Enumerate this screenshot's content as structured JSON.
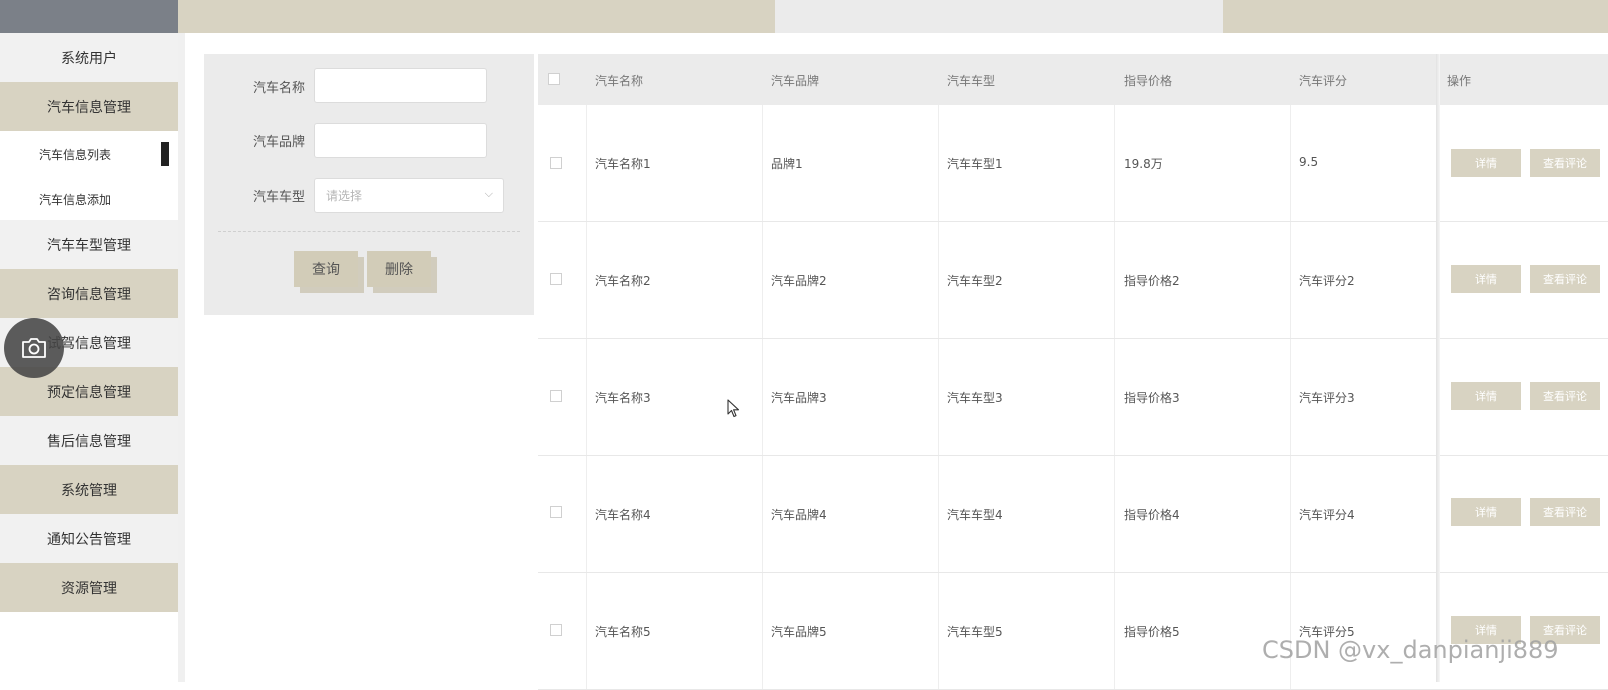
{
  "sidebar": {
    "items": [
      {
        "label": "系统用户"
      },
      {
        "label": "汽车信息管理"
      },
      {
        "label": "汽车车型管理"
      },
      {
        "label": "咨询信息管理"
      },
      {
        "label": "试驾信息管理"
      },
      {
        "label": "预定信息管理"
      },
      {
        "label": "售后信息管理"
      },
      {
        "label": "系统管理"
      },
      {
        "label": "通知公告管理"
      },
      {
        "label": "资源管理"
      }
    ],
    "subitems": [
      {
        "label": "汽车信息列表"
      },
      {
        "label": "汽车信息添加"
      }
    ]
  },
  "search": {
    "name_label": "汽车名称",
    "brand_label": "汽车品牌",
    "type_label": "汽车车型",
    "type_placeholder": "请选择",
    "query_button": "查询",
    "delete_button": "删除"
  },
  "table": {
    "columns": [
      "汽车名称",
      "汽车品牌",
      "汽车车型",
      "指导价格",
      "汽车评分",
      "操作"
    ],
    "rows": [
      {
        "name": "汽车名称1",
        "brand": "品牌1",
        "type": "汽车车型1",
        "price": "19.8万",
        "score": "9.5"
      },
      {
        "name": "汽车名称2",
        "brand": "汽车品牌2",
        "type": "汽车车型2",
        "price": "指导价格2",
        "score": "汽车评分2"
      },
      {
        "name": "汽车名称3",
        "brand": "汽车品牌3",
        "type": "汽车车型3",
        "price": "指导价格3",
        "score": "汽车评分3"
      },
      {
        "name": "汽车名称4",
        "brand": "汽车品牌4",
        "type": "汽车车型4",
        "price": "指导价格4",
        "score": "汽车评分4"
      },
      {
        "name": "汽车名称5",
        "brand": "汽车品牌5",
        "type": "汽车车型5",
        "price": "指导价格5",
        "score": "汽车评分5"
      }
    ],
    "detail_label": "详情",
    "review_label": "查看评论"
  },
  "watermark": "CSDN @vx_danpianji889",
  "colors": {
    "accent": "#d8d3c2",
    "sidebar_top": "#7b8088",
    "panel": "#ebebeb"
  },
  "icons": {
    "floating": "camera-icon",
    "select": "chevron-down-icon",
    "pointer": "cursor-arrow-icon"
  }
}
